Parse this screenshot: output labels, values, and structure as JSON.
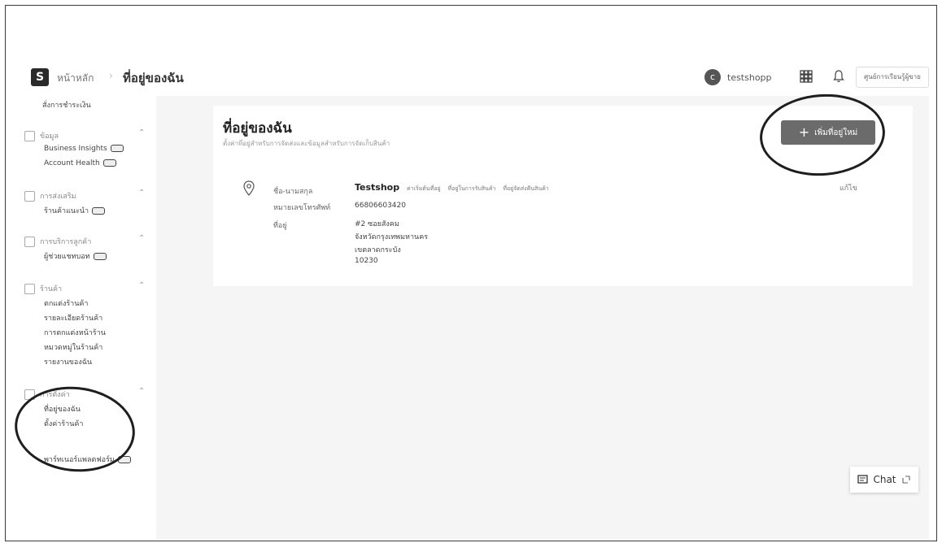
{
  "topbar": {
    "logo_glyph": "S",
    "breadcrumb_home": "หน้าหลัก",
    "breadcrumb_sep": "›",
    "breadcrumb_current": "ที่อยู่ของฉัน",
    "user_initial": "c",
    "user_name": "testshopp",
    "seller_center_button": "ศูนย์การเรียนรู้ผู้ขาย"
  },
  "sidebar": {
    "top_item": "สั่งการชำระเงิน",
    "sections": [
      {
        "title": "ข้อมูล",
        "items": [
          "Business Insights",
          "Account Health"
        ]
      },
      {
        "title": "การส่งเสริม",
        "items": [
          "ร้านค้าแนะนำ"
        ]
      },
      {
        "title": "การบริการลูกค้า",
        "items": [
          "ผู้ช่วยแชทบอท"
        ]
      },
      {
        "title": "ร้านค้า",
        "items": [
          "ตกแต่งร้านค้า",
          "รายละเอียดร้านค้า",
          "การตกแต่งหน้าร้าน",
          "หมวดหมู่ในร้านค้า",
          "รายงานของฉัน"
        ]
      },
      {
        "title": "การตั้งค่า",
        "items": [
          "ที่อยู่ของฉัน",
          "ตั้งค่าร้านค้า",
          "พาร์ทเนอร์แพลตฟอร์ม"
        ]
      }
    ]
  },
  "main": {
    "title": "ที่อยู่ของฉัน",
    "subtitle": "ตั้งค่าที่อยู่สำหรับการจัดส่งและข้อมูลสำหรับการจัดเก็บสินค้า",
    "add_button": "เพิ่มที่อยู่ใหม่",
    "address": {
      "name_label": "ชื่อ-นามสกุล",
      "name": "Testshop",
      "tags": [
        "ค่าเริ่มต้นที่อยู่",
        "ที่อยู่ในการรับสินค้า",
        "ที่อยู่จัดส่งคืนสินค้า"
      ],
      "phone_label": "หมายเลขโทรศัพท์",
      "phone": "66806603420",
      "address_label": "ที่อยู่",
      "address_lines": [
        "#2 ซอยสังคม",
        "จังหวัดกรุงเทพมหานคร",
        "เขตลาดกระบัง",
        "10230"
      ],
      "edit": "แก้ไข"
    }
  },
  "chat": {
    "label": "Chat"
  },
  "colors": {
    "annotation": "#1e1e1e",
    "button": "#6b6b6b"
  }
}
